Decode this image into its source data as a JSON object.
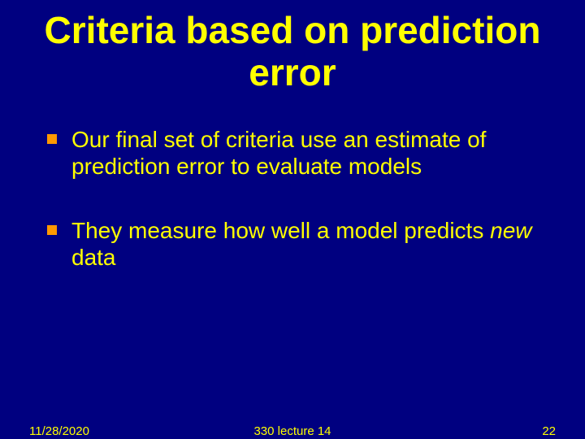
{
  "title": "Criteria based on prediction error",
  "bullets": [
    {
      "text": "Our final set of criteria use an estimate of prediction error to evaluate models"
    },
    {
      "prefix": "They measure how well a model predicts ",
      "emph": "new",
      "suffix": " data"
    }
  ],
  "footer": {
    "date": "11/28/2020",
    "center": "330 lecture 14",
    "page": "22"
  }
}
